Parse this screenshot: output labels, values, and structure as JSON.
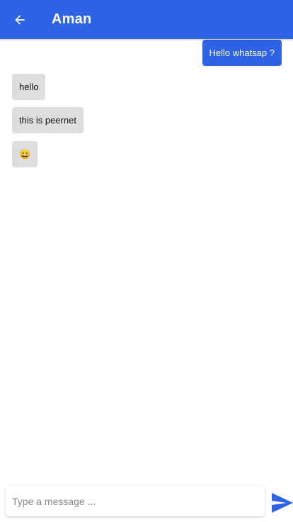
{
  "header": {
    "title": "Aman",
    "back_icon": "arrow-left-icon"
  },
  "messages": [
    {
      "direction": "outgoing",
      "text": "Hello whatsap ?"
    },
    {
      "direction": "incoming",
      "text": "hello"
    },
    {
      "direction": "incoming",
      "text": "this is peernet"
    },
    {
      "direction": "incoming",
      "text": "😀"
    }
  ],
  "composer": {
    "placeholder": "Type a message ...",
    "value": "",
    "send_icon": "send-icon"
  },
  "colors": {
    "accent": "#2e63e6",
    "incoming_bubble": "#dedede",
    "background": "#ffffff"
  }
}
